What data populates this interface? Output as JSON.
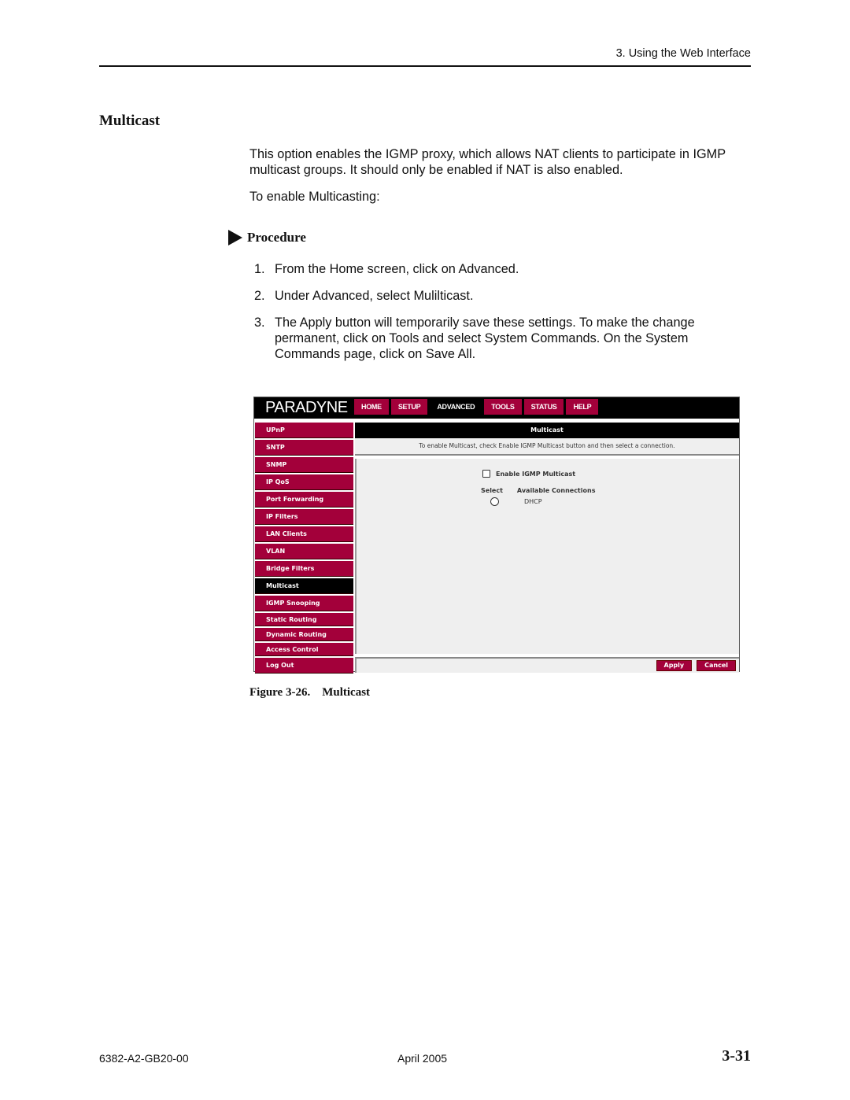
{
  "header": {
    "running_head": "3. Using the Web Interface"
  },
  "section": {
    "title": "Multicast",
    "intro": "This option enables the IGMP proxy, which allows NAT clients to participate in IGMP multicast groups. It should only be enabled if NAT is also enabled.",
    "lead_in": "To enable Multicasting:",
    "procedure_label": "Procedure",
    "steps": [
      {
        "num": "1.",
        "text": "From the Home screen, click on Advanced."
      },
      {
        "num": "2.",
        "text": "Under Advanced, select Mulilticast."
      },
      {
        "num": "3.",
        "text": "The Apply button will temporarily save these settings. To make the change permanent, click on Tools and select System Commands. On the System Commands page, click on Save All."
      }
    ]
  },
  "figure": {
    "caption": "Figure 3-26.    Multicast",
    "screenshot": {
      "logo": "PARADYNE",
      "nav_tabs": [
        {
          "label": "HOME",
          "active": false
        },
        {
          "label": "SETUP",
          "active": false
        },
        {
          "label": "ADVANCED",
          "active": true
        },
        {
          "label": "TOOLS",
          "active": false
        },
        {
          "label": "STATUS",
          "active": false
        },
        {
          "label": "HELP",
          "active": false
        }
      ],
      "sidebar": [
        {
          "label": "UPnP",
          "active": false
        },
        {
          "label": "SNTP",
          "active": false
        },
        {
          "label": "SNMP",
          "active": false
        },
        {
          "label": "IP QoS",
          "active": false
        },
        {
          "label": "Port Forwarding",
          "active": false
        },
        {
          "label": "IP Filters",
          "active": false
        },
        {
          "label": "LAN Clients",
          "active": false
        },
        {
          "label": "VLAN",
          "active": false
        },
        {
          "label": "Bridge Filters",
          "active": false
        },
        {
          "label": "Multicast",
          "active": true
        },
        {
          "label": "IGMP Snooping",
          "active": false
        },
        {
          "label": "Static Routing",
          "active": false
        },
        {
          "label": "Dynamic Routing",
          "active": false
        },
        {
          "label": "Access Control",
          "active": false
        },
        {
          "label": "Log Out",
          "active": false
        }
      ],
      "panel_title": "Multicast",
      "hint": "To enable Multicast, check Enable IGMP Multicast button and then select a connection.",
      "enable_label": "Enable IGMP Multicast",
      "enable_checked": false,
      "select_header": "Select",
      "connections_header": "Available Connections",
      "connections": [
        {
          "name": "DHCP",
          "selected": false
        }
      ],
      "apply_label": "Apply",
      "cancel_label": "Cancel",
      "colors": {
        "brand": "#a3003a",
        "bar": "#000000",
        "panel": "#efefef"
      }
    }
  },
  "footer": {
    "doc_number": "6382-A2-GB20-00",
    "date": "April 2005",
    "page_number": "3-31"
  }
}
